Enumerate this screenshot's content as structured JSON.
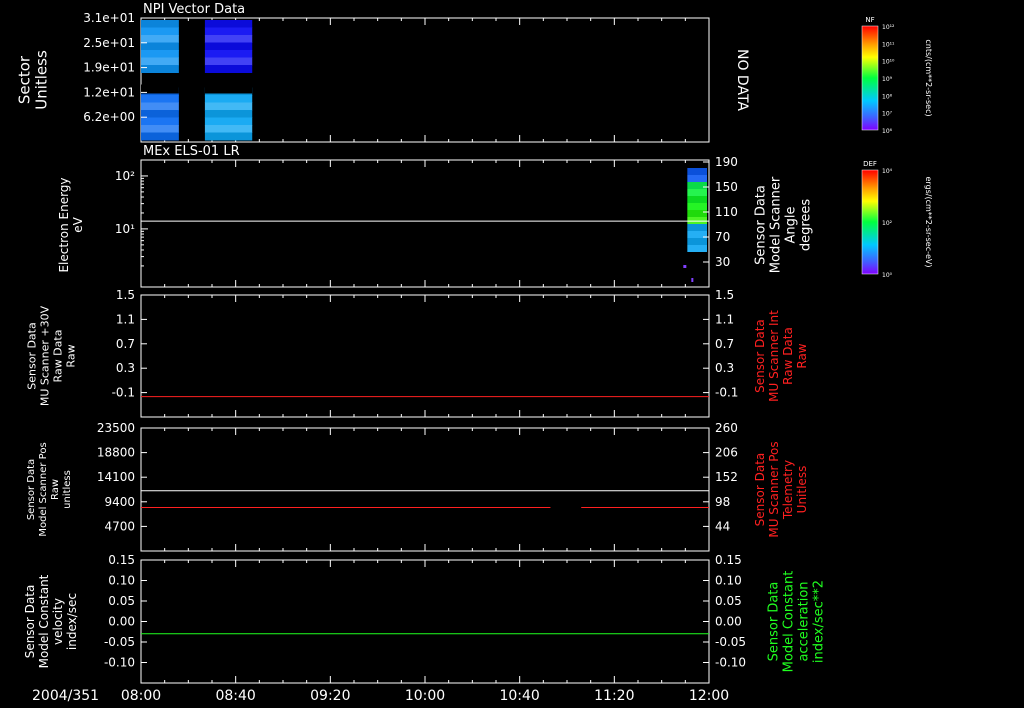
{
  "date_label": "2004/351",
  "time_ticks": [
    "08:00",
    "08:40",
    "09:20",
    "10:00",
    "10:40",
    "11:20",
    "12:00"
  ],
  "chart_data": [
    {
      "type": "heatmap",
      "title": "NPI Vector Data",
      "ylabel": "Sector",
      "yunit": "Unitless",
      "yticks": [
        "3.1e+01",
        "2.5e+01",
        "1.9e+01",
        "1.2e+01",
        "6.2e+00"
      ],
      "right_note": "NO DATA",
      "data_spans": [
        [
          "08:00",
          "08:16"
        ],
        [
          "08:27",
          "08:47"
        ]
      ],
      "gap_row": 19,
      "colorbar": {
        "label": "NF",
        "unit": "cnts/(cm**2-sr-sec)",
        "ticks": [
          "10¹²",
          "10¹¹",
          "10¹⁰",
          "10⁹",
          "10⁸",
          "10⁷",
          "10⁶"
        ]
      }
    },
    {
      "type": "heatmap",
      "title": "MEx ELS-01 LR",
      "ylabel": "Electron Energy",
      "yunit": "eV",
      "yticks_log": [
        {
          "label": "10²",
          "value": 100
        },
        {
          "label": "10¹",
          "value": 10
        }
      ],
      "ylim": [
        0.8,
        200
      ],
      "series": [
        {
          "name": "Sensor Data Model Scanner Angle",
          "y": 14
        }
      ],
      "right_label": [
        "Sensor Data",
        "Model Scanner",
        "Angle",
        "degrees"
      ],
      "right_ticks": [
        "190",
        "150",
        "110",
        "70",
        "30"
      ],
      "data_spans": [
        [
          "11:50",
          "12:00"
        ]
      ],
      "colorbar": {
        "label": "DEF",
        "unit": "ergs/(cm**2-sr-sec-eV)",
        "ticks": [
          "10⁴",
          "10²",
          "10⁰"
        ]
      }
    },
    {
      "type": "line",
      "ylabel": [
        "Sensor Data",
        "MU Scanner +30V",
        "Raw Data",
        "Raw"
      ],
      "ylim": [
        -0.3,
        1.5
      ],
      "yticks": [
        "1.5",
        "1.1",
        "0.7",
        "0.3",
        "-0.1"
      ],
      "right_ticks": [
        "1.5",
        "1.1",
        "0.7",
        "0.3",
        "-0.1"
      ],
      "right_label": [
        "Sensor Data",
        "MU Scanner Int",
        "Raw Data",
        "Raw"
      ],
      "series": [
        {
          "name": "Sensor Data MU Scanner Int Raw Data",
          "color": "#ff2020",
          "y": 0.0,
          "x_ranges": [
            [
              "08:00",
              "12:00"
            ]
          ]
        }
      ]
    },
    {
      "type": "line",
      "ylabel": [
        "Sensor Data",
        "Model Scanner Pos",
        "Raw",
        "unitless"
      ],
      "ylim": [
        0,
        23500
      ],
      "yticks": [
        "23500",
        "18800",
        "14100",
        "9400",
        "4700"
      ],
      "right_ticks": [
        "260",
        "206",
        "152",
        "98",
        "44"
      ],
      "right_label": [
        "Sensor Data",
        "MU Scanner Pos",
        "Telemetry",
        "Unitless"
      ],
      "series": [
        {
          "name": "Sensor Data Model Scanner Pos Raw",
          "color": "#ffffff",
          "y": 11500,
          "x_ranges": [
            [
              "08:00",
              "12:00"
            ]
          ]
        },
        {
          "name": "Sensor Data MU Scanner Pos Telemetry",
          "color": "#ff2020",
          "y": 8300,
          "x_ranges": [
            [
              "08:00",
              "10:53"
            ],
            [
              "11:06",
              "12:00"
            ]
          ]
        }
      ]
    },
    {
      "type": "line",
      "ylabel": [
        "Sensor Data",
        "Model Constant",
        "velocity",
        "index/sec"
      ],
      "ylim": [
        -0.1,
        0.15
      ],
      "yticks": [
        "0.15",
        "0.10",
        "0.05",
        "0.00",
        "-0.05",
        "-0.10"
      ],
      "right_ticks": [
        "0.15",
        "0.10",
        "0.05",
        "0.00",
        "-0.05",
        "-0.10"
      ],
      "right_label": [
        "Sensor Data",
        "Model Constant",
        "acceleration",
        "index/sec**2"
      ],
      "series": [
        {
          "name": "Sensor Data Model Constant acceleration",
          "color": "#20ff20",
          "y": 0.0,
          "x_ranges": [
            [
              "08:00",
              "12:00"
            ]
          ]
        }
      ]
    }
  ]
}
